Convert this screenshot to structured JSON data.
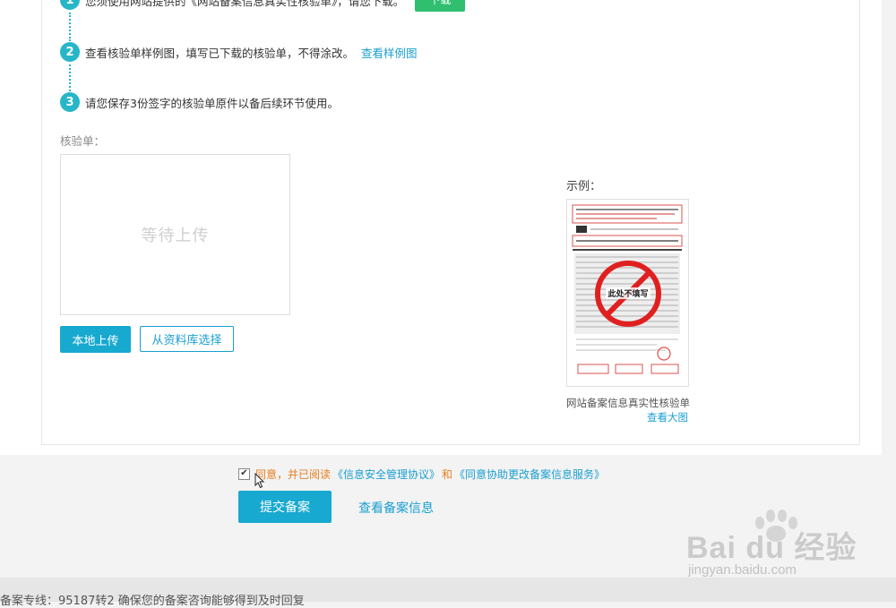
{
  "steps": [
    {
      "num": "1",
      "text": "您须使用网站提供的《网站备案信息真实性核验单》，请您下载。",
      "button": "下载"
    },
    {
      "num": "2",
      "text": "查看核验单样例图，填写已下载的核验单，不得涂改。",
      "link": "查看样例图"
    },
    {
      "num": "3",
      "text": "请您保存3份签字的核验单原件以备后续环节使用。"
    }
  ],
  "upload": {
    "label": "核验单：",
    "placeholder": "等待上传",
    "local_button": "本地上传",
    "library_button": "从资料库选择"
  },
  "example": {
    "label": "示例：",
    "caption": "网站备案信息真实性核验单",
    "link": "查看大图",
    "stamp_text": "此处不填写"
  },
  "agreement": {
    "checked": true,
    "prefix": "同意，并已阅读",
    "doc1": "《信息安全管理协议》",
    "joiner": "和",
    "doc2": "《同意协助更改备案信息服务》"
  },
  "actions": {
    "submit": "提交备案",
    "view_info": "查看备案信息"
  },
  "footer": {
    "text": "备案专线：95187转2 确保您的备案咨询能够得到及时回复"
  },
  "watermark": {
    "brand": "Bai du 经验",
    "url": "jingyan.baidu.com"
  },
  "colors": {
    "accent": "#18a9d0",
    "step": "#26b6c8",
    "download": "#2fbf6f",
    "agree": "#e67e22"
  }
}
